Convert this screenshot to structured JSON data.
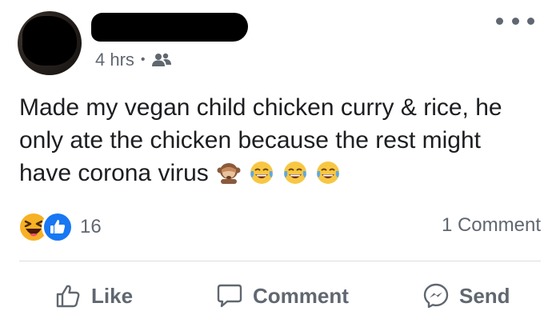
{
  "post": {
    "timestamp": "4 hrs",
    "separator": "•",
    "audience_icon": "friends-icon",
    "text": "Made my vegan child chicken curry & rice, he only ate the chicken because the rest might have corona virus",
    "inline_emojis": [
      "see-no-evil-monkey-icon",
      "joy-icon",
      "joy-icon",
      "joy-icon"
    ]
  },
  "reactions": {
    "types": [
      "haha",
      "like"
    ],
    "count": "16"
  },
  "comments": {
    "label": "1 Comment"
  },
  "actions": {
    "like_label": "Like",
    "comment_label": "Comment",
    "send_label": "Send"
  },
  "colors": {
    "text": "#1c1e21",
    "secondary_text": "#606770",
    "like_blue": "#1877f2",
    "haha_yellow": "#f7b125",
    "divider": "#dadde1"
  }
}
